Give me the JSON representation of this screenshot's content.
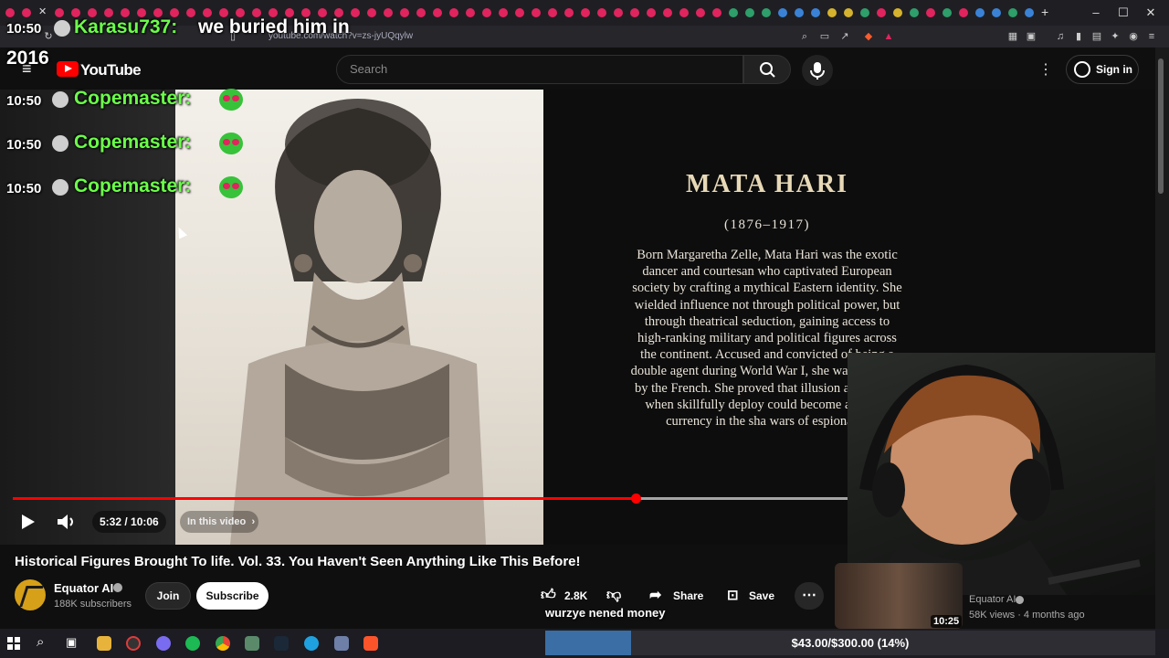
{
  "browser": {
    "url": "youtube.com/watch?v=zs-jyUQqylw",
    "window_controls": [
      "–",
      "☐",
      "✕"
    ]
  },
  "youtube": {
    "wordmark": "YouTube",
    "search_placeholder": "Search",
    "sign_in": "Sign in"
  },
  "overlay_panel": {
    "title": "Mata Hari",
    "years": "(1876–1917)",
    "bio": "Born Margaretha Zelle, Mata Hari was the exotic dancer and courtesan who captivated European society by crafting a mythical Eastern identity. She wielded influence not through political power, but through theatrical seduction, gaining access to high-ranking military and political figures across the continent. Accused and convicted of being a double agent during World War I, she was executed by the French. She proved that illusion and allure, when skillfully deploy could become a deadly currency in the sha wars of espionage."
  },
  "player": {
    "time": "5:32 / 10:06",
    "chapter_chip": "In this video",
    "progress_fraction": 0.551,
    "buffer_fraction": 0.768
  },
  "video": {
    "title": "Historical Figures Brought To life. Vol. 33. You Haven't Seen Anything Like This Before!",
    "channel_name": "Equator AI",
    "subscribers": "188K subscribers",
    "join_label": "Join",
    "subscribe_label": "Subscribe",
    "likes": "2.8K",
    "share_label": "Share",
    "save_label": "Save"
  },
  "recommended": {
    "duration": "10:25",
    "channel": "Equator AI",
    "meta": "58K views · 4 months ago"
  },
  "stream_chat": {
    "top_time": "10:50",
    "top_user": "Karasu737:",
    "top_msg": "we buried him in",
    "top_msg_cont": "2016",
    "lines": [
      {
        "time": "10:50",
        "user": "Copemaster:"
      },
      {
        "time": "10:50",
        "user": "Copemaster:"
      },
      {
        "time": "10:50",
        "user": "Copemaster:"
      }
    ]
  },
  "stream_overlay": {
    "caption": "wurzye nened money",
    "goal_text": "$43.00/$300.00 (14%)",
    "goal_fraction": 0.14
  },
  "colors": {
    "brand_red": "#ff0000",
    "chat_username": "#6bff4a",
    "panel_title": "#e8d9b7"
  }
}
